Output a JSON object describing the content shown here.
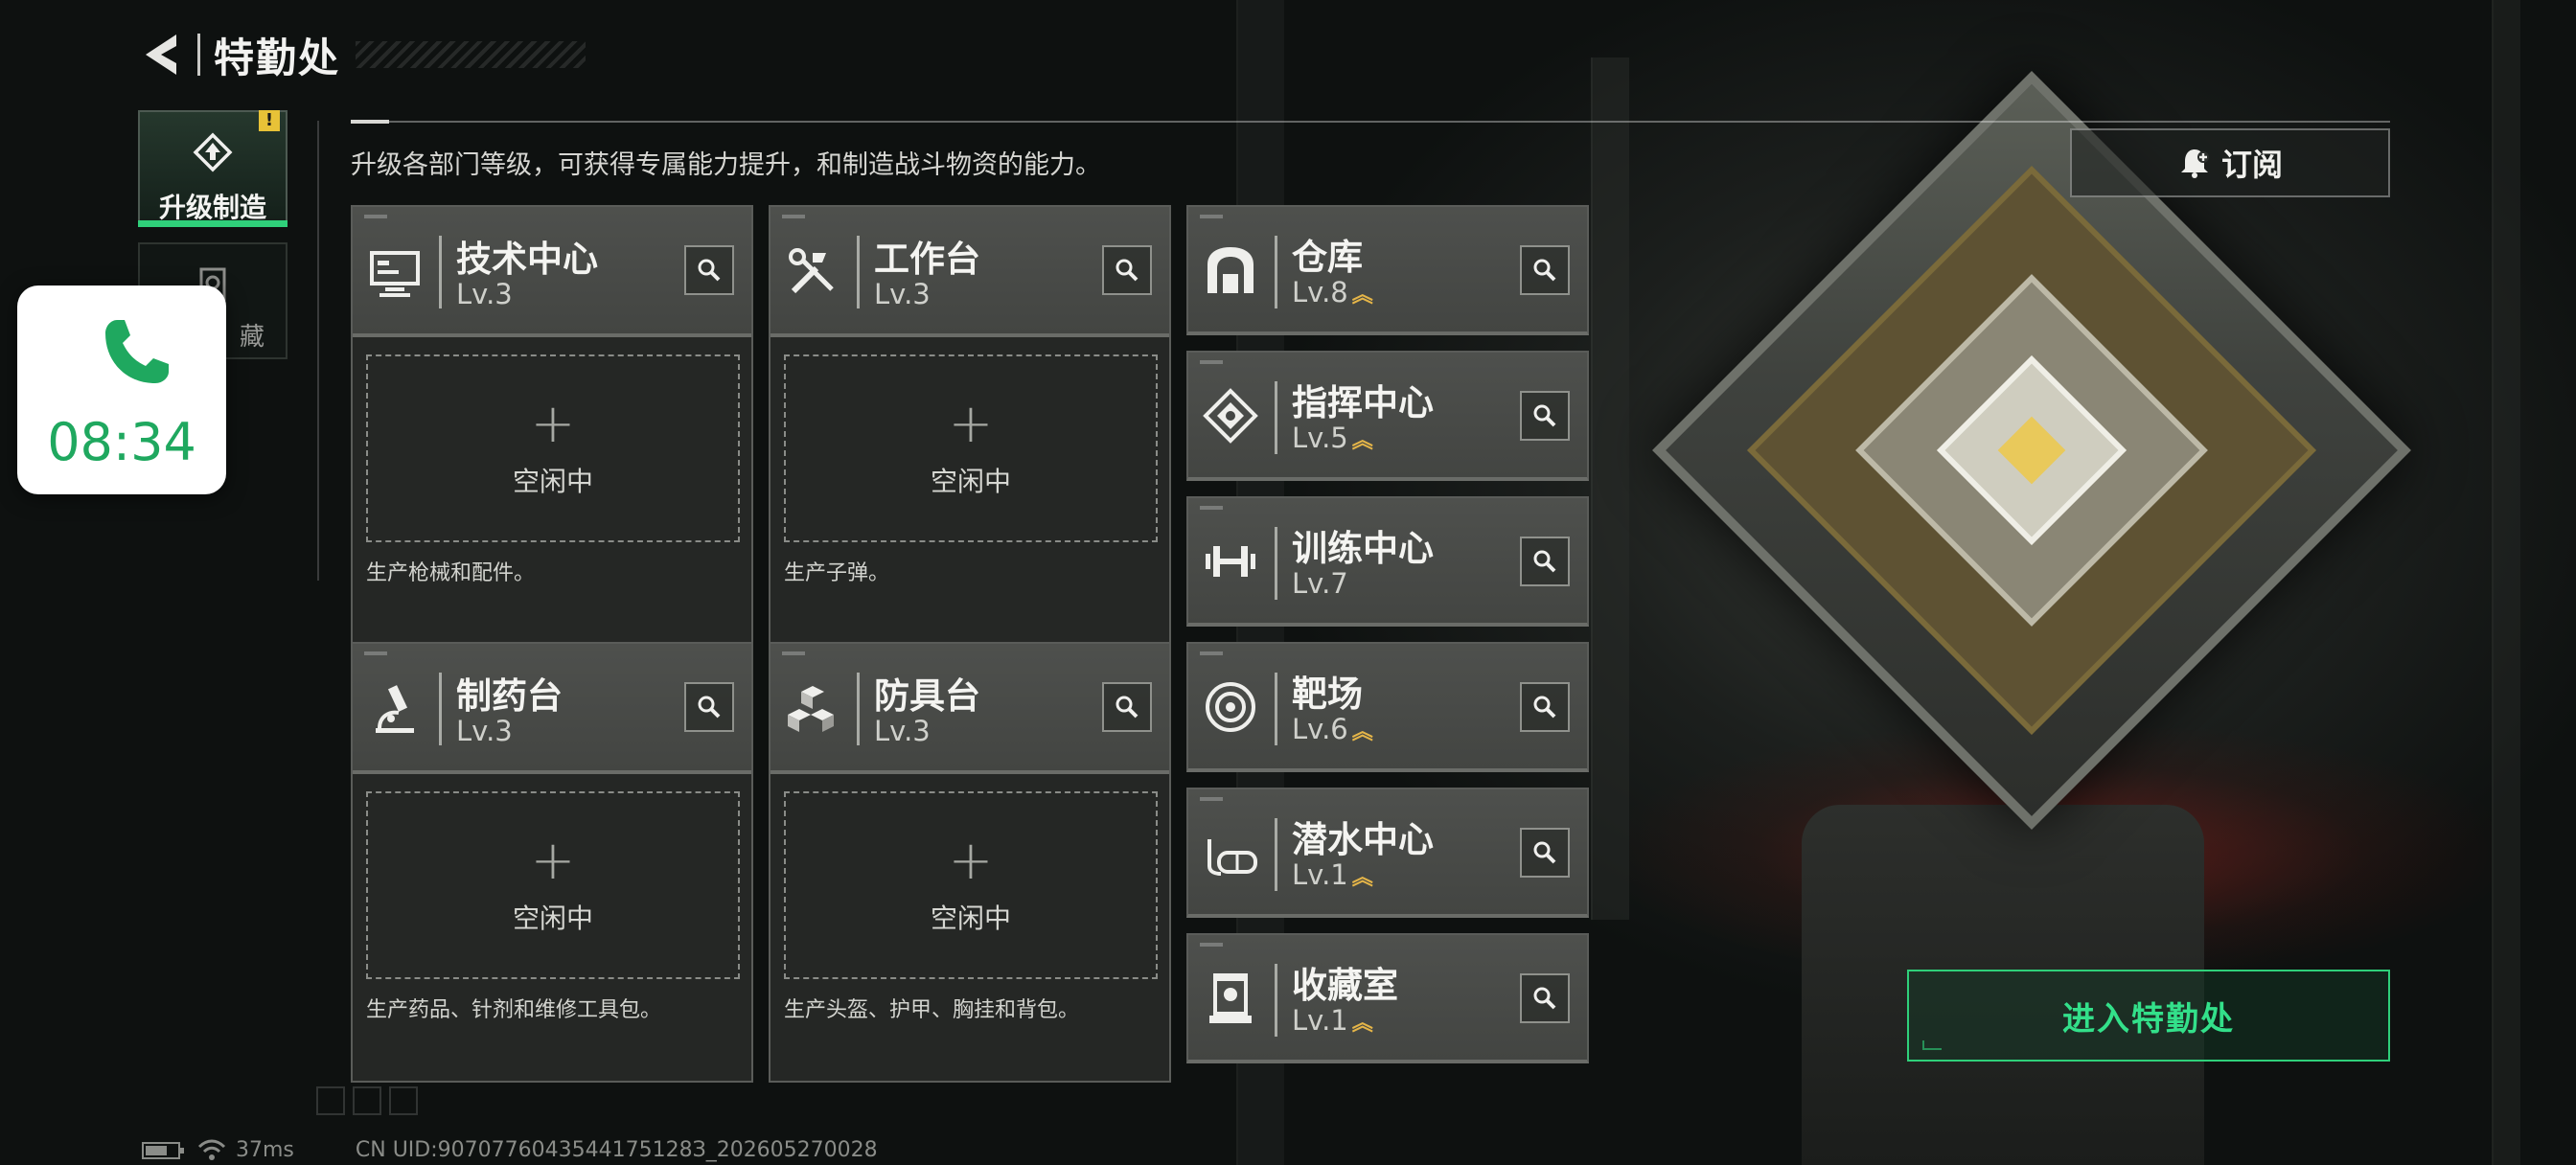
{
  "header": {
    "title": "特勤处",
    "back_icon": "back-arrow-icon"
  },
  "left_nav": {
    "items": [
      {
        "label": "升级制造",
        "icon": "upgrade-build-icon",
        "active": true,
        "alert": "!"
      },
      {
        "label": "藏",
        "icon": "collection-icon",
        "active": false
      }
    ]
  },
  "call_overlay": {
    "time": "08:34",
    "icon": "phone-icon",
    "color": "#1fa85f"
  },
  "description": "升级各部门等级，可获得专属能力提升，和制造战斗物资的能力。",
  "subscribe": {
    "label": "订阅",
    "icon": "bell-plus-icon"
  },
  "production_cards": [
    {
      "name": "技术中心",
      "level": "Lv.3",
      "icon": "computer-icon",
      "slot_status": "空闲中",
      "slot_plus": "+",
      "description": "生产枪械和配件。"
    },
    {
      "name": "工作台",
      "level": "Lv.3",
      "icon": "tools-icon",
      "slot_status": "空闲中",
      "slot_plus": "+",
      "description": "生产子弹。"
    },
    {
      "name": "制药台",
      "level": "Lv.3",
      "icon": "microscope-icon",
      "slot_status": "空闲中",
      "slot_plus": "+",
      "description": "生产药品、针剂和维修工具包。"
    },
    {
      "name": "防具台",
      "level": "Lv.3",
      "icon": "armor-cubes-icon",
      "slot_status": "空闲中",
      "slot_plus": "+",
      "description": "生产头盔、护甲、胸挂和背包。"
    }
  ],
  "facility_cards": [
    {
      "name": "仓库",
      "level": "Lv.8",
      "upgradable": true,
      "icon": "warehouse-icon"
    },
    {
      "name": "指挥中心",
      "level": "Lv.5",
      "upgradable": true,
      "icon": "command-chip-icon"
    },
    {
      "name": "训练中心",
      "level": "Lv.7",
      "upgradable": false,
      "icon": "dumbbell-icon"
    },
    {
      "name": "靶场",
      "level": "Lv.6",
      "upgradable": true,
      "icon": "target-icon"
    },
    {
      "name": "潜水中心",
      "level": "Lv.1",
      "upgradable": true,
      "icon": "diving-mask-icon"
    },
    {
      "name": "收藏室",
      "level": "Lv.1",
      "upgradable": true,
      "icon": "trophy-case-icon"
    }
  ],
  "upgrade_arrows": "︽",
  "enter_button": {
    "label": "进入特勤处",
    "color": "#33e08a"
  },
  "status_bar": {
    "ping": "37ms",
    "uid": "CN UID:9070776043544175128З_202605270028"
  }
}
